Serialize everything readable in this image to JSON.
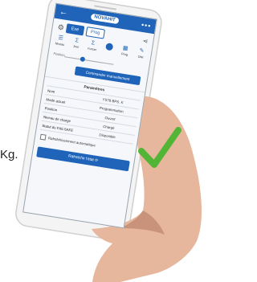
{
  "side_text": "Kg.",
  "app": {
    "header": {
      "back_icon": "←",
      "logo_text": "NOVAHIT",
      "menu_icon": "•••"
    },
    "tabs": [
      {
        "label": "Exe",
        "active": true
      },
      {
        "label": "Prog",
        "active": false
      }
    ],
    "tools": [
      {
        "label": "Niveau",
        "icon": "levels-icon"
      },
      {
        "label": "Jour",
        "icon": "sum-icon"
      },
      {
        "label": "Forcer",
        "icon": "force-icon"
      },
      {
        "label": "",
        "icon": "mode-icon"
      },
      {
        "label": "Prog",
        "icon": "prog-icon"
      },
      {
        "label": "Dist",
        "icon": "dist-icon"
      }
    ],
    "slider": {
      "label": "Position",
      "value_label": "50%"
    },
    "command_button": "Commander manuellement",
    "params_title": "Paramètres",
    "params": [
      {
        "key": "Nom",
        "value": "YS78 BPS. K"
      },
      {
        "key": "Mode actuel",
        "value": "Programmation"
      },
      {
        "key": "Position",
        "value": "Ouvert"
      },
      {
        "key": "Niveau de charge",
        "value": "Chargé"
      },
      {
        "key": "Statut du FAILSAFE",
        "value": "Disponible"
      }
    ],
    "auto_refresh_label": "Rafraîchissement automatique",
    "refresh_button": "Rafraîchir l'état ⟳"
  },
  "colors": {
    "primary": "#1f64b8",
    "check": "#53b535",
    "skin": "#e6b79c"
  }
}
